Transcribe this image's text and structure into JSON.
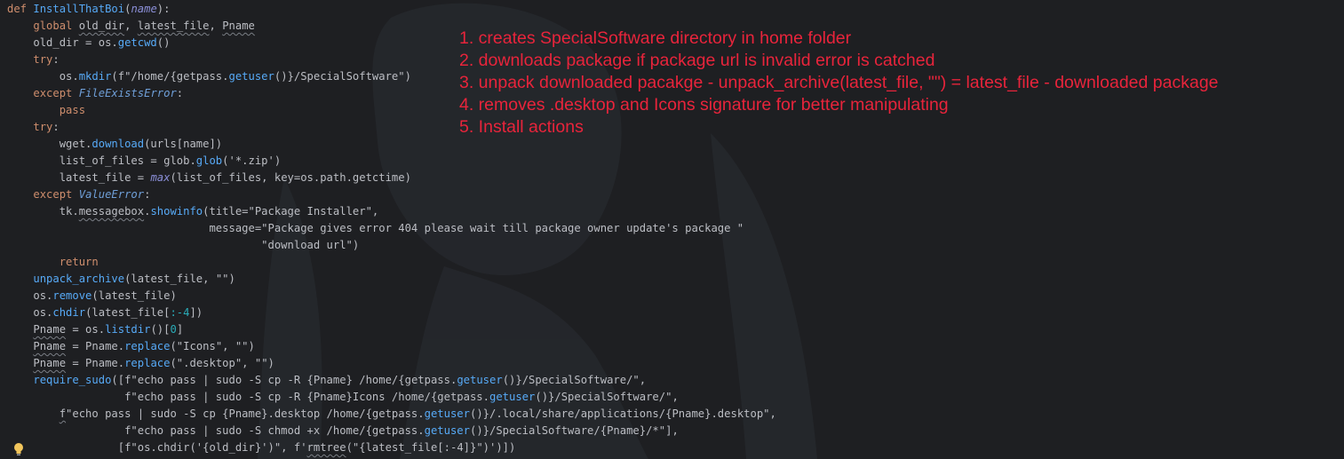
{
  "editor": {
    "code_lines": [
      {
        "indent": 0,
        "parts": [
          [
            "kw",
            "def "
          ],
          [
            "fn",
            "InstallThatBoi"
          ],
          [
            "p",
            "("
          ],
          [
            "param",
            "name"
          ],
          [
            "p",
            "):"
          ]
        ]
      },
      {
        "indent": 4,
        "parts": [
          [
            "kw",
            "global "
          ],
          [
            "ul",
            "old_dir"
          ],
          [
            "p",
            ", "
          ],
          [
            "ul",
            "latest_file"
          ],
          [
            "p",
            ", "
          ],
          [
            "ul",
            "Pname"
          ]
        ]
      },
      {
        "indent": 4,
        "parts": [
          [
            "p",
            "old_dir = os."
          ],
          [
            "call",
            "getcwd"
          ],
          [
            "p",
            "()"
          ]
        ]
      },
      {
        "indent": 4,
        "parts": [
          [
            "kw",
            "try"
          ],
          [
            "p",
            ":"
          ]
        ]
      },
      {
        "indent": 8,
        "parts": [
          [
            "p",
            "os."
          ],
          [
            "call",
            "mkdir"
          ],
          [
            "p",
            "(f\"/home/{getpass."
          ],
          [
            "call",
            "getuser"
          ],
          [
            "p",
            "()}/SpecialSoftware\")"
          ]
        ]
      },
      {
        "indent": 4,
        "parts": [
          [
            "kw",
            "except "
          ],
          [
            "cls",
            "FileExistsError"
          ],
          [
            "p",
            ":"
          ]
        ]
      },
      {
        "indent": 8,
        "parts": [
          [
            "kw",
            "pass"
          ]
        ]
      },
      {
        "indent": 4,
        "parts": [
          [
            "kw",
            "try"
          ],
          [
            "p",
            ":"
          ]
        ]
      },
      {
        "indent": 8,
        "parts": [
          [
            "p",
            "wget."
          ],
          [
            "call",
            "download"
          ],
          [
            "p",
            "(urls[name])"
          ]
        ]
      },
      {
        "indent": 8,
        "parts": [
          [
            "p",
            "list_of_files = glob."
          ],
          [
            "call",
            "glob"
          ],
          [
            "p",
            "('*.zip')"
          ]
        ]
      },
      {
        "indent": 8,
        "parts": [
          [
            "p",
            "latest_file = "
          ],
          [
            "param",
            "max"
          ],
          [
            "p",
            "(list_of_files, key=os.path.getctime)"
          ]
        ]
      },
      {
        "indent": 4,
        "parts": [
          [
            "kw",
            "except "
          ],
          [
            "cls",
            "ValueError"
          ],
          [
            "p",
            ":"
          ]
        ]
      },
      {
        "indent": 8,
        "parts": [
          [
            "p",
            "tk."
          ],
          [
            "ul",
            "messagebox"
          ],
          [
            "p",
            "."
          ],
          [
            "call",
            "showinfo"
          ],
          [
            "p",
            "(title=\"Package Installer\","
          ]
        ]
      },
      {
        "indent": 8,
        "parts": [
          [
            "p",
            "                       message=\"Package gives error 404 please wait till package owner update's package \""
          ]
        ]
      },
      {
        "indent": 8,
        "parts": [
          [
            "p",
            "                               \"download url\")"
          ]
        ]
      },
      {
        "indent": 8,
        "parts": [
          [
            "kw",
            "return"
          ]
        ]
      },
      {
        "indent": 4,
        "parts": [
          [
            "call",
            "unpack_archive"
          ],
          [
            "p",
            "(latest_file, \"\")"
          ]
        ]
      },
      {
        "indent": 4,
        "parts": [
          [
            "p",
            "os."
          ],
          [
            "call",
            "remove"
          ],
          [
            "p",
            "(latest_file)"
          ]
        ]
      },
      {
        "indent": 4,
        "parts": [
          [
            "p",
            "os."
          ],
          [
            "call",
            "chdir"
          ],
          [
            "p",
            "(latest_file["
          ],
          [
            "num",
            ":-4"
          ],
          [
            "p",
            "])"
          ]
        ]
      },
      {
        "indent": 4,
        "parts": [
          [
            "ul",
            "Pname"
          ],
          [
            "p",
            " = os."
          ],
          [
            "call",
            "listdir"
          ],
          [
            "p",
            "()["
          ],
          [
            "num",
            "0"
          ],
          [
            "p",
            "]"
          ]
        ]
      },
      {
        "indent": 4,
        "parts": [
          [
            "ul",
            "Pname"
          ],
          [
            "p",
            " = Pname."
          ],
          [
            "call",
            "replace"
          ],
          [
            "p",
            "(\"Icons\", \"\")"
          ]
        ]
      },
      {
        "indent": 4,
        "parts": [
          [
            "ul",
            "Pname"
          ],
          [
            "p",
            " = Pname."
          ],
          [
            "call",
            "replace"
          ],
          [
            "p",
            "(\".desktop\", \"\")"
          ]
        ]
      },
      {
        "indent": 4,
        "parts": [
          [
            "call",
            "require_sudo"
          ],
          [
            "p",
            "([f\"echo pass | sudo -S cp -R {Pname} /home/{getpass."
          ],
          [
            "call",
            "getuser"
          ],
          [
            "p",
            "()}/SpecialSoftware/\","
          ]
        ]
      },
      {
        "indent": 4,
        "parts": [
          [
            "p",
            "              f\"echo pass | sudo -S cp -R {Pname}Icons /home/{getpass."
          ],
          [
            "call",
            "getuser"
          ],
          [
            "p",
            "()}/SpecialSoftware/\","
          ]
        ]
      },
      {
        "indent": 8,
        "parts": [
          [
            "ul",
            "f"
          ],
          [
            "p",
            "\"echo pass | sudo -S cp {Pname}.desktop /home/{getpass."
          ],
          [
            "call",
            "getuser"
          ],
          [
            "p",
            "()}/.local/share/applications/{Pname}.desktop\","
          ]
        ]
      },
      {
        "indent": 4,
        "parts": [
          [
            "p",
            "              f\"echo pass | sudo -S chmod +x /home/{getpass."
          ],
          [
            "call",
            "getuser"
          ],
          [
            "p",
            "()}/SpecialSoftware/{Pname}/*\"],"
          ]
        ]
      },
      {
        "indent": 4,
        "parts": [
          [
            "p",
            "             [f\"os.chdir('{old_dir}')\", f'"
          ],
          [
            "ul",
            "rmtree"
          ],
          [
            "p",
            "(\"{latest_file[:-4]}\")')])"
          ]
        ]
      }
    ]
  },
  "notes": [
    "1. creates SpecialSoftware directory in home folder",
    "2. downloads package if package url is invalid error is catched",
    "3. unpack downloaded pacakge - unpack_archive(latest_file, \"\") = latest_file - downloaded package",
    "4. removes .desktop and Icons signature for better manipulating",
    "5. Install actions"
  ],
  "colors": {
    "background": "#1e1f22",
    "note_text": "#e8243b",
    "keyword": "#cf8e6d",
    "function": "#56a8f5",
    "number": "#2aacb8"
  },
  "icons": {
    "gutter": "lightbulb-icon"
  }
}
